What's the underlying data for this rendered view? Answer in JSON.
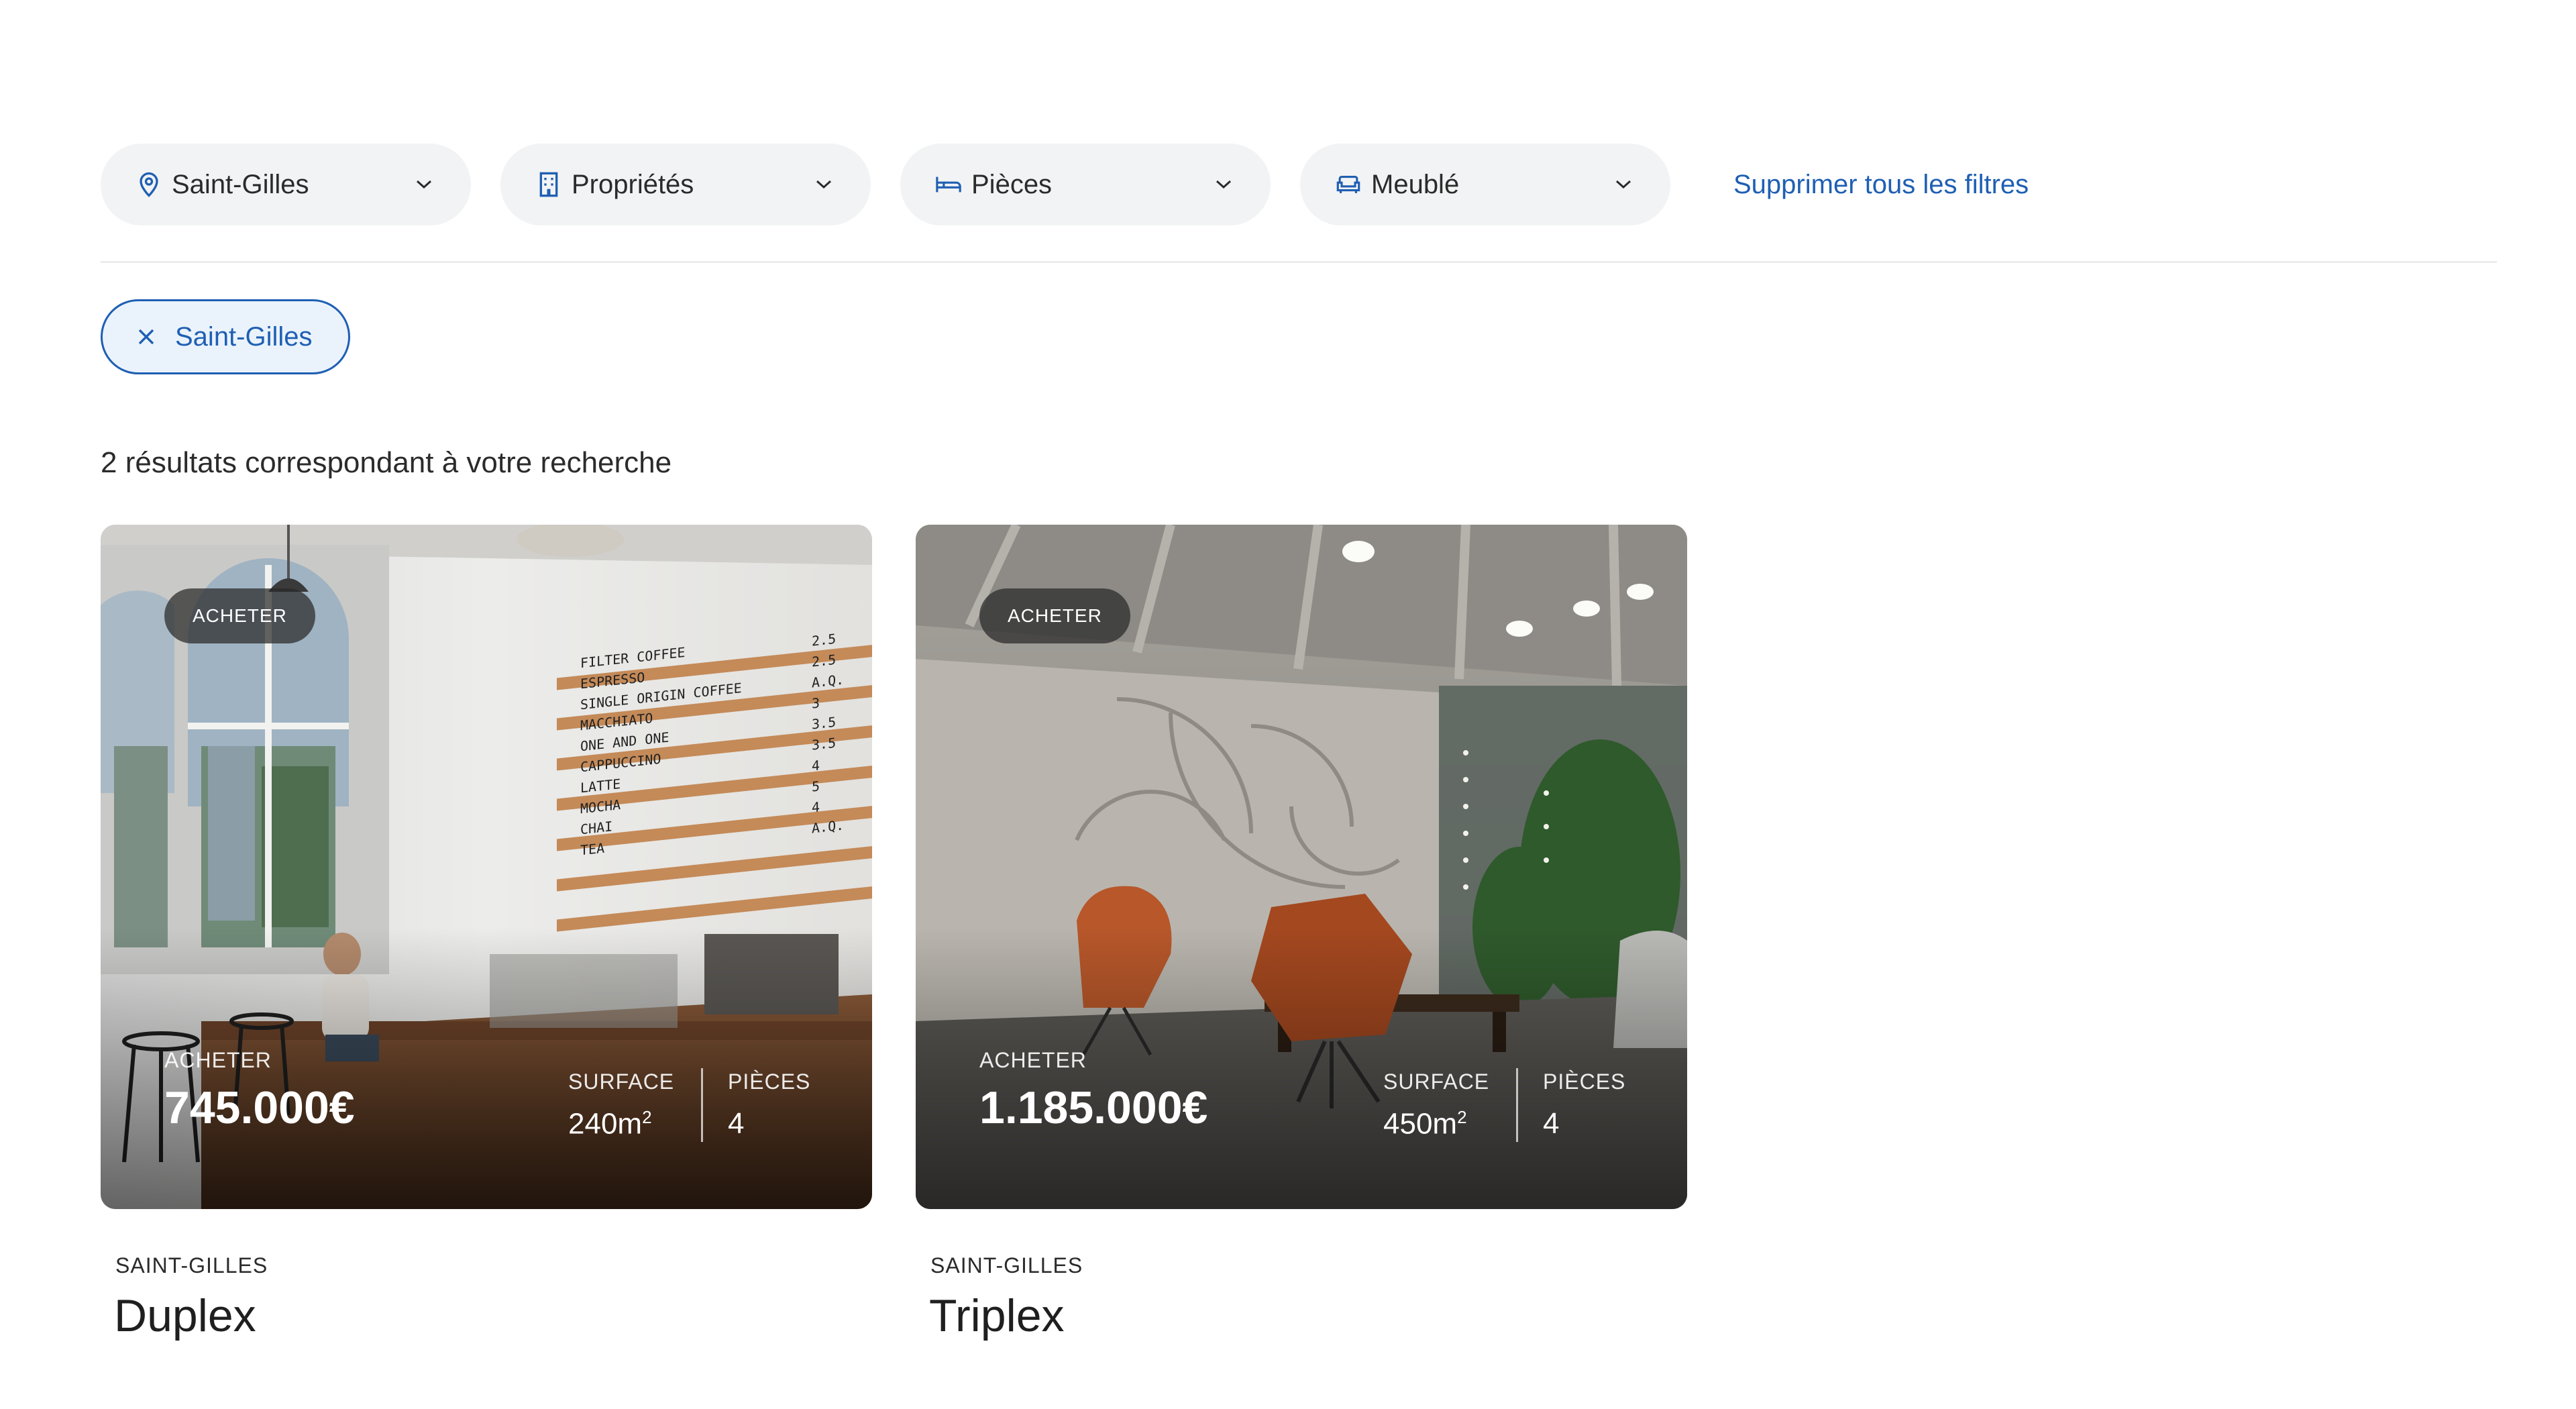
{
  "filters": [
    {
      "label": "Saint-Gilles",
      "icon": "location-pin-icon"
    },
    {
      "label": "Propriétés",
      "icon": "building-icon"
    },
    {
      "label": "Pièces",
      "icon": "bed-icon"
    },
    {
      "label": "Meublé",
      "icon": "sofa-icon"
    }
  ],
  "clear_filters_label": "Supprimer tous les filtres",
  "active_chip": {
    "label": "Saint-Gilles"
  },
  "results_count": "2 résultats correspondant à votre recherche",
  "listings": [
    {
      "badge": "ACHETER",
      "price_label": "ACHETER",
      "price": "745.000€",
      "surface_label": "SURFACE",
      "surface_value": "240m",
      "surface_unit_sup": "2",
      "rooms_label": "PIÈCES",
      "rooms_value": "4",
      "location": "SAINT-GILLES",
      "title": "Duplex"
    },
    {
      "badge": "ACHETER",
      "price_label": "ACHETER",
      "price": "1.185.000€",
      "surface_label": "SURFACE",
      "surface_value": "450m",
      "surface_unit_sup": "2",
      "rooms_label": "PIÈCES",
      "rooms_value": "4",
      "location": "SAINT-GILLES",
      "title": "Triplex"
    }
  ],
  "menu_board": [
    "FILTER COFFEE",
    "ESPRESSO",
    "SINGLE ORIGIN COFFEE",
    "MACCHIATO",
    "ONE AND ONE",
    "CAPPUCCINO",
    "LATTE",
    "MOCHA",
    "CHAI",
    "TEA"
  ],
  "menu_prices": [
    "2.5",
    "2.5",
    "A.Q.",
    "3",
    "3.5",
    "3.5",
    "4",
    "5",
    "4",
    "A.Q."
  ],
  "colors": {
    "accent": "#1f5fb3",
    "chip_bg": "#eaf3fc",
    "pill_bg": "#f2f3f4"
  }
}
